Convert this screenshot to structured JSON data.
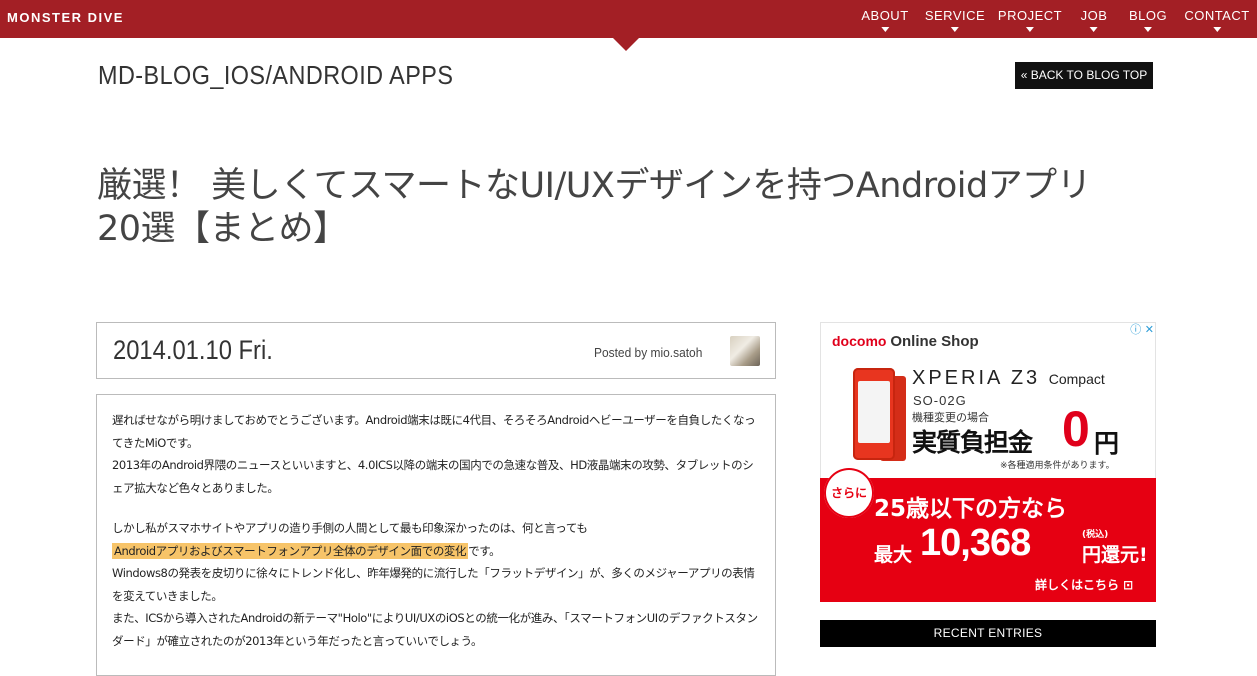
{
  "brand": {
    "logo_text": "MONSTER DIVE",
    "accent_color": "#a31f25"
  },
  "nav": {
    "items": [
      {
        "label": "ABOUT"
      },
      {
        "label": "SERVICE"
      },
      {
        "label": "PROJECT"
      },
      {
        "label": "JOB"
      },
      {
        "label": "BLOG"
      },
      {
        "label": "CONTACT"
      }
    ],
    "caret_icon": "caret-down-icon"
  },
  "header": {
    "blog_title": "MD-BLOG_IOS/ANDROID APPS",
    "back_button_label": "« BACK TO BLOG TOP"
  },
  "post": {
    "title_line1": "厳選！ 美しくてスマートなUI/UXデザインを持つAndroidアプリ",
    "title_line2": "20選【まとめ】",
    "date": "2014.01.10 Fri.",
    "posted_by": "Posted by mio.satoh",
    "body": {
      "p1": "遅ればせながら明けましておめでとうございます。Android端末は既に4代目、そろそろAndroidヘビーユーザーを自負したくなってきたMiOです。",
      "p2": "2013年のAndroid界隈のニュースといいますと、4.0ICS以降の端末の国内での急速な普及、HD液晶端末の攻勢、タブレットのシェア拡大など色々とありました。",
      "p3_pre": "しかし私がスマホサイトやアプリの造り手側の人間として最も印象深かったのは、何と言っても",
      "p3_highlight": "Androidアプリおよびスマートフォンアプリ全体のデザイン面での変化",
      "p3_post": "です。",
      "p4": "Windows8の発表を皮切りに徐々にトレンド化し、昨年爆発的に流行した「フラットデザイン」が、多くのメジャーアプリの表情を変えていきました。",
      "p5": "また、ICSから導入されたAndroidの新テーマ\"Holo\"によりUI/UXのiOSとの統一化が進み、「スマートフォンUIのデファクトスタンダード」が確立されたのが2013年という年だったと言っていいでしょう。"
    }
  },
  "ad": {
    "close_icons": "ⓘ ✕",
    "shop_brand_prefix": "docomo",
    "shop_brand_name": "Online Shop",
    "product_name": "XPERIA Z3",
    "product_suffix": "Compact",
    "model": "SO-02G",
    "case_label": "機種変更の場合",
    "price_label": "実質負担金",
    "price_value": "0",
    "price_unit": "円",
    "note": "※各種適用条件があります。",
    "badge": "さらに",
    "age_line": "25歳以下の方なら",
    "max_label": "最大",
    "amount": "10,368",
    "tax_label": "(税込)",
    "refund_label": "円還元!",
    "detail_link": "詳しくはこちら ⊡",
    "accent_red": "#e60012"
  },
  "sidebar": {
    "recent_heading": "RECENT ENTRIES"
  }
}
